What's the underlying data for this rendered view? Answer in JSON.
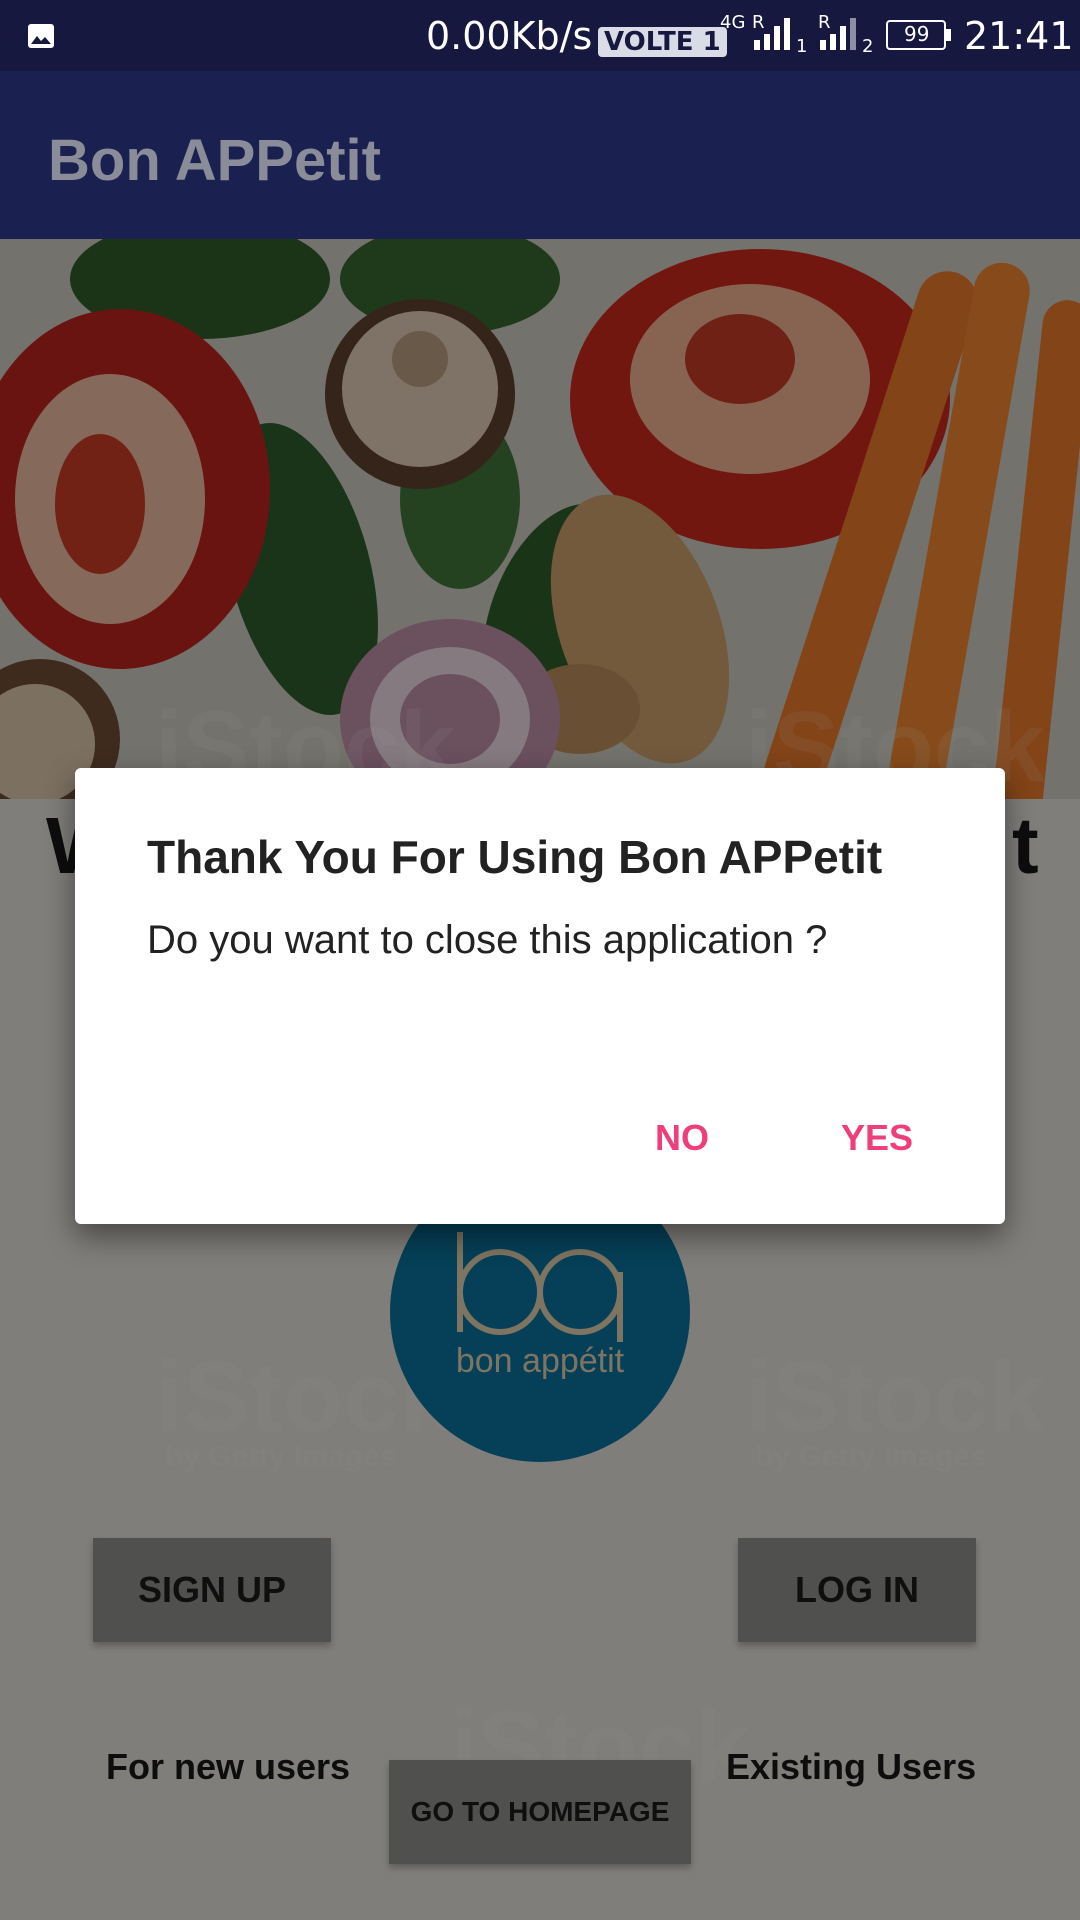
{
  "status_bar": {
    "net_speed": "0.00Kb/s",
    "volte": "VOLTE 1",
    "network_type": "4G",
    "roaming_1": "R",
    "sim_1": "1",
    "roaming_2": "R",
    "sim_2": "2",
    "battery": "99",
    "time": "21:41",
    "icons": [
      "image-icon",
      "signal-icon",
      "battery-icon"
    ]
  },
  "app_bar": {
    "title": "Bon APPetit"
  },
  "background": {
    "welcome_left": "W",
    "welcome_right": "t",
    "logo_text": "bon appétit",
    "logo_color": "#0a6f98",
    "sign_up": "SIGN UP",
    "log_in": "LOG IN",
    "for_new_users": "For new users",
    "existing_users": "Existing Users",
    "go_to_homepage": "GO TO HOMEPAGE",
    "watermark": "iStock",
    "watermark_sub": "by Getty Images"
  },
  "dialog": {
    "title": "Thank You For Using Bon APPetit",
    "message": "Do you want to close this application ?",
    "no_label": "NO",
    "yes_label": "YES",
    "accent": "#ee3f7b"
  }
}
